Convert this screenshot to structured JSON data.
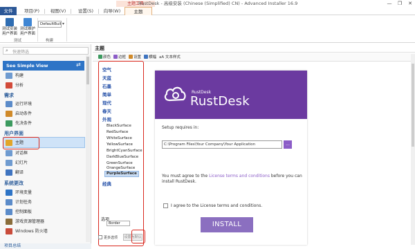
{
  "window": {
    "title": "RustDesk - 高级安装 (Chinese (Simplified) CN) - Advanced Installer 16.9",
    "context_tab_label": "主题工具",
    "controls": [
      "—",
      "❐",
      "✕"
    ]
  },
  "ribbon": {
    "tabs": [
      {
        "label": "文件",
        "kind": "file"
      },
      {
        "label": "项目(P)",
        "kind": "normal"
      },
      {
        "label": "视图(V)",
        "kind": "normal"
      },
      {
        "label": "设置(S)",
        "kind": "normal"
      },
      {
        "label": "向导(W)",
        "kind": "normal"
      },
      {
        "label": "主题",
        "kind": "active"
      }
    ],
    "buttons": [
      {
        "label": "测试安装 用户界面"
      },
      {
        "label": "测试维护 用户界面"
      }
    ],
    "build_combo": "DefaultBuild",
    "groups": [
      "测试",
      "构建"
    ]
  },
  "left_panel": {
    "search_placeholder": "快速筛选",
    "simple_view_label": "See Simple View",
    "sections": [
      {
        "title": "",
        "items": [
          {
            "label": "构建",
            "color": "#6f9bd0"
          },
          {
            "label": "分析",
            "color": "#d24b3a"
          }
        ]
      },
      {
        "title": "需求",
        "items": [
          {
            "label": "运行环境",
            "color": "#5b8bc9"
          },
          {
            "label": "启动条件",
            "color": "#d08a2a"
          },
          {
            "label": "先决条件",
            "color": "#3c9a5f"
          }
        ]
      },
      {
        "title": "用户界面",
        "items": [
          {
            "label": "主题",
            "color": "#e2a528"
          },
          {
            "label": "对话框",
            "color": "#6f9bd0"
          },
          {
            "label": "幻灯片",
            "color": "#6f9bd0"
          },
          {
            "label": "翻译",
            "color": "#3f74c0"
          }
        ]
      },
      {
        "title": "系统更改",
        "items": [
          {
            "label": "环境变量",
            "color": "#2e74c6"
          },
          {
            "label": "计划任务",
            "color": "#5b8bc9"
          },
          {
            "label": "控制面板",
            "color": "#5b8bc9"
          },
          {
            "label": "游戏资源管理器",
            "color": "#8a6d3b"
          },
          {
            "label": "Windows 防火墙",
            "color": "#c94b3a"
          }
        ]
      }
    ],
    "footer_link": "项目总结"
  },
  "main": {
    "header": "主题",
    "toolbar": [
      {
        "label": "颜色",
        "color": "#3c9a5f"
      },
      {
        "label": "边框",
        "color": "#8b5cc7"
      },
      {
        "label": "设置",
        "color": "#d08a2a"
      },
      {
        "label": "横幅",
        "color": "#3f74c0"
      },
      {
        "label": "aA 文本样式",
        "color": ""
      }
    ],
    "theme_groups": [
      {
        "label": "空气",
        "items": []
      },
      {
        "label": "天蓝",
        "items": []
      },
      {
        "label": "石墨",
        "items": []
      },
      {
        "label": "简单",
        "items": []
      },
      {
        "label": "现代",
        "items": []
      },
      {
        "label": "春天",
        "items": []
      },
      {
        "label": "外观",
        "items": [
          "BlackSurface",
          "RedSurface",
          "WhiteSurface",
          "YellowSurface",
          "BrightCyanSurface",
          "DarkBlueSurface",
          "GreenSurface",
          "OrangeSurface",
          "PurpleSurface"
        ]
      },
      {
        "label": "经典",
        "items": []
      }
    ],
    "selected_theme": "PurpleSurface",
    "options_label": "选项",
    "options_select": "Border",
    "footer_checkbox_label": "更多选项",
    "set_default_button": "设置为默认"
  },
  "preview": {
    "brand_small": "RustDesk",
    "brand_big": "RustDesk",
    "setup_requires": "Setup requires in:",
    "install_path": "C:\\Program Files\\Your Company\\Your Application",
    "browse_label": "...",
    "agree_prefix": "You must agree to the ",
    "agree_link": "License terms and conditions",
    "agree_suffix": " before you can install RustDesk.",
    "license_checkbox_label": "I agree to the License terms and conditions.",
    "install_button": "INSTALL",
    "colors": {
      "header": "#6b3aa0",
      "accent": "#8b5cc7"
    }
  }
}
